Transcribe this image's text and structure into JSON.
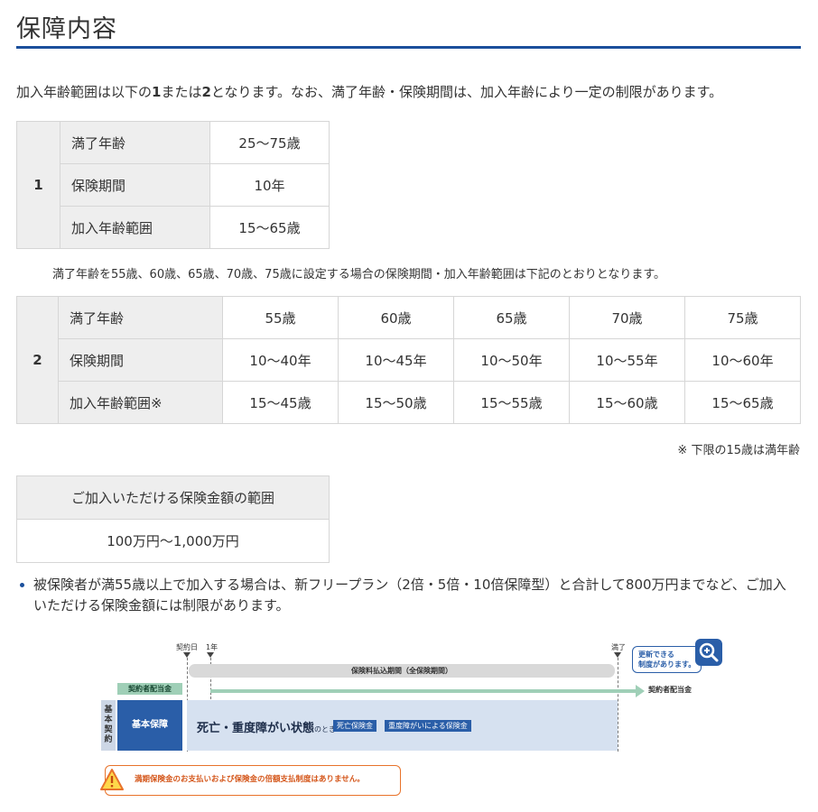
{
  "page_title": "保障内容",
  "intro": {
    "part1": "加入年齢範囲は以下の",
    "num1": "1",
    "part2": "または",
    "num2": "2",
    "part3": "となります。なお、満了年齢・保険期間は、加入年齢により一定の制限があります。"
  },
  "table1": {
    "number": "1",
    "rows": [
      {
        "label": "満了年齢",
        "value": "25〜75歳"
      },
      {
        "label": "保険期間",
        "value": "10年"
      },
      {
        "label": "加入年齢範囲",
        "value": "15〜65歳"
      }
    ]
  },
  "note1": "満了年齢を55歳、60歳、65歳、70歳、75歳に設定する場合の保険期間・加入年齢範囲は下記のとおりとなります。",
  "table2": {
    "number": "2",
    "rows": [
      {
        "label": "満了年齢",
        "values": [
          "55歳",
          "60歳",
          "65歳",
          "70歳",
          "75歳"
        ]
      },
      {
        "label": "保険期間",
        "values": [
          "10〜40年",
          "10〜45年",
          "10〜50年",
          "10〜55年",
          "10〜60年"
        ]
      },
      {
        "label": "加入年齢範囲※",
        "values": [
          "15〜45歳",
          "15〜50歳",
          "15〜55歳",
          "15〜60歳",
          "15〜65歳"
        ]
      }
    ]
  },
  "note2": "※ 下限の15歳は満年齢",
  "table3": {
    "header": "ご加入いただける保険金額の範囲",
    "value": "100万円〜1,000万円"
  },
  "bullet": "被保険者が満55歳以上で加入する場合は、新フリープラン（2倍・5倍・10倍保障型）と合計して800万円までなど、ご加入いただける保険金額には制限があります。",
  "diagram": {
    "contract_day": "契約日",
    "one_year": "1年",
    "maturity": "満了",
    "premium_period": "保険料払込期間（全保険期間）",
    "dividend_tab": "契約者配当金",
    "dividend_end": "契約者配当金",
    "renewal_bubble_1": "更新できる",
    "renewal_bubble_2": "制度があります。",
    "side_label": "基本契約",
    "basic_label": "基本保障",
    "main_text": "死亡・重度障がい状態",
    "main_text_suffix": "のとき",
    "chip1": "死亡保険金",
    "chip2": "重度障がいによる保険金",
    "warning": "満期保険金のお支払いおよび保険金の倍額支払制度はありません。",
    "colors": {
      "blue": "#2a5ea8",
      "green": "#9fcfb7",
      "orange": "#e8732b",
      "band": "#d6e1f0"
    }
  }
}
